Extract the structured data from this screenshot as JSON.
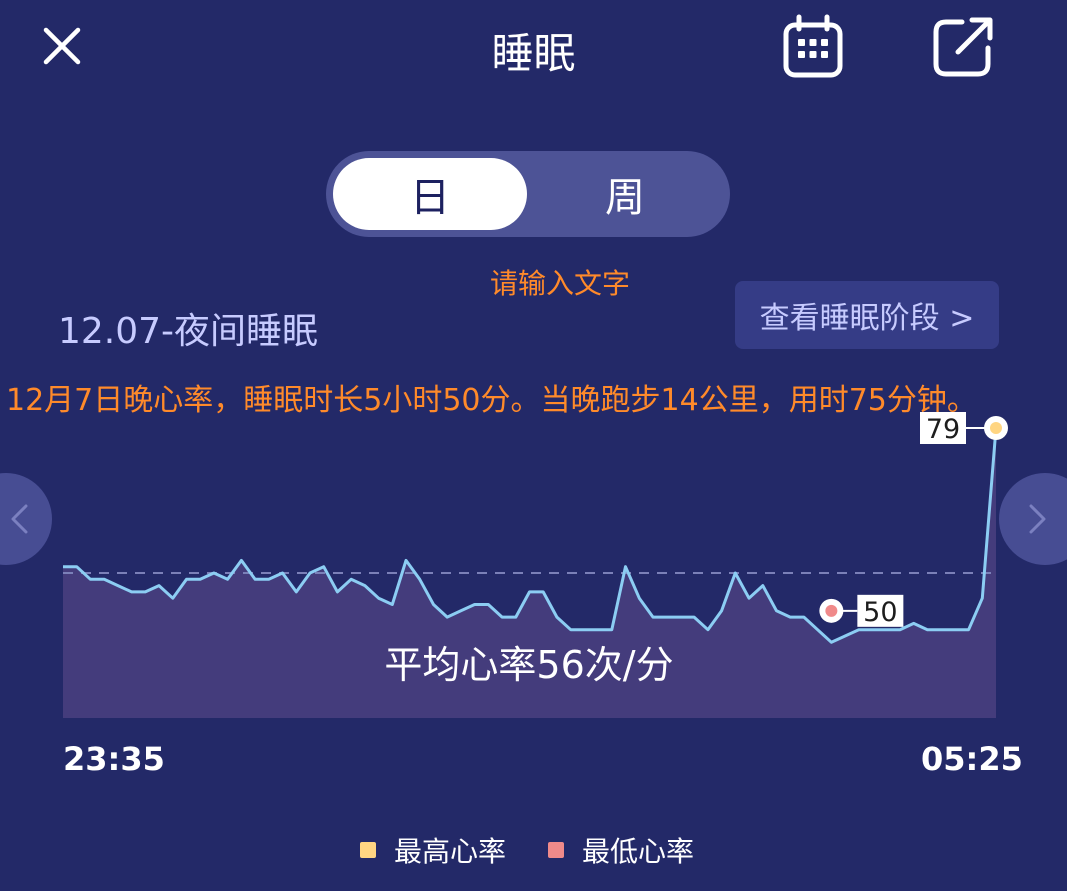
{
  "header": {
    "title": "睡眠",
    "close_icon": "close-icon",
    "calendar_icon": "calendar-icon",
    "share_icon": "share-icon"
  },
  "tabs": [
    {
      "label": "日",
      "selected": true
    },
    {
      "label": "周",
      "selected": false
    }
  ],
  "input": {
    "placeholder": "请输入文字"
  },
  "section": {
    "date_label": "12.07-夜间睡眠",
    "stage_button": "查看睡眠阶段 >"
  },
  "summary": "12月7日晚心率，睡眠时长5小时50分。当晚跑步14公里，用时75分钟。",
  "nav": {
    "prev_icon": "chevron-left-icon",
    "next_icon": "chevron-right-icon"
  },
  "chart_data": {
    "type": "area",
    "values": [
      57,
      57,
      55,
      55,
      54,
      53,
      53,
      54,
      52,
      55,
      55,
      56,
      55,
      58,
      55,
      55,
      56,
      53,
      56,
      57,
      53,
      55,
      54,
      52,
      51,
      58,
      55,
      51,
      49,
      50,
      51,
      51,
      49,
      49,
      53,
      53,
      49,
      47,
      47,
      47,
      47,
      57,
      52,
      49,
      49,
      49,
      49,
      47,
      50,
      56,
      52,
      54,
      50,
      49,
      49,
      47,
      45,
      46,
      47,
      47,
      47,
      47,
      48,
      47,
      47,
      47,
      47,
      52,
      79
    ],
    "avg": 56,
    "max": {
      "value": 79,
      "label": "79",
      "index": 68
    },
    "min": {
      "value": 50,
      "label": "50",
      "index": 56
    },
    "avg_label": "平均心率56次/分",
    "x_start": "23:35",
    "x_end": "05:25",
    "ylim": [
      33,
      79
    ],
    "legend": [
      {
        "name": "最高心率",
        "color": "#ffd582"
      },
      {
        "name": "最低心率",
        "color": "#f08a8a"
      }
    ],
    "colors": {
      "line": "#8ccdf3",
      "fill": "#443c7c",
      "avg_line": "#7b80b8"
    }
  }
}
